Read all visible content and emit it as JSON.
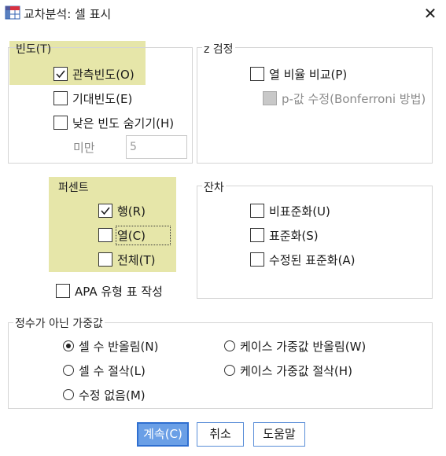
{
  "window": {
    "title": "교차분석: 셀 표시",
    "close_glyph": "✕",
    "app_icon": "crosstab-icon"
  },
  "counts": {
    "legend": "빈도(T)",
    "observed": {
      "label": "관측빈도(O)",
      "checked": true
    },
    "expected": {
      "label": "기대빈도(E)",
      "checked": false
    },
    "hide_small": {
      "label": "낮은 빈도 숨기기(H)",
      "checked": false
    },
    "less_than_label": "미만",
    "less_than_value": "5"
  },
  "ztest": {
    "legend": "z 검정",
    "compare_col": {
      "label": "열 비율 비교(P)",
      "checked": false
    },
    "bonferroni": {
      "label": "p-값 수정(Bonferroni 방법)",
      "checked": false,
      "disabled": true
    }
  },
  "percentages": {
    "legend": "퍼센트",
    "row": {
      "label": "행(R)",
      "checked": true
    },
    "column": {
      "label": "열(C)",
      "checked": false
    },
    "total": {
      "label": "전체(T)",
      "checked": false
    }
  },
  "apa": {
    "label": "APA 유형 표 작성",
    "checked": false
  },
  "residuals": {
    "legend": "잔차",
    "unstandardized": {
      "label": "비표준화(U)",
      "checked": false
    },
    "standardized": {
      "label": "표준화(S)",
      "checked": false
    },
    "adjusted": {
      "label": "수정된 표준화(A)",
      "checked": false
    }
  },
  "weights": {
    "legend": "정수가 아닌 가중값",
    "round_cell": {
      "label": "셀 수 반올림(N)",
      "selected": true
    },
    "round_case": {
      "label": "케이스 가중값 반올림(W)",
      "selected": false
    },
    "truncate_cell": {
      "label": "셀 수 절삭(L)",
      "selected": false
    },
    "truncate_case": {
      "label": "케이스 가중값 절삭(H)",
      "selected": false
    },
    "no_adjust": {
      "label": "수정 없음(M)",
      "selected": false
    }
  },
  "buttons": {
    "continue": "계속(C)",
    "cancel": "취소",
    "help": "도움말"
  },
  "colors": {
    "highlight": "#e2e29a",
    "primary_button": "#6a9fe6",
    "primary_border": "#2f6fd0"
  }
}
